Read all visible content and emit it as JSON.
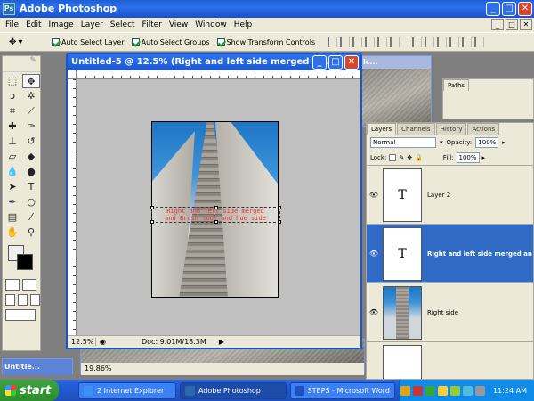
{
  "app": {
    "title": "Adobe Photoshop",
    "icon_letters": "Ps"
  },
  "window_controls": {
    "minimize": "_",
    "maximize": "□",
    "close": "✕"
  },
  "menu": [
    "File",
    "Edit",
    "Image",
    "Layer",
    "Select",
    "Filter",
    "View",
    "Window",
    "Help"
  ],
  "options_bar": {
    "auto_select_layer": "Auto Select Layer",
    "auto_select_groups": "Auto Select Groups",
    "show_transform_controls": "Show Transform Controls"
  },
  "document": {
    "title": "Untitled-5 @ 12.5% (Right and left side merged  an, ...",
    "overlay_line1": "Right and left side merged",
    "overlay_line2": "and Brush tool and hue side",
    "zoom": "12.5%",
    "doc_size": "Doc: 9.01M/18.3M"
  },
  "back_documents": {
    "minimized_title": "Untitle...",
    "behind_zoom": "19.86%",
    "partial_title": "lc..."
  },
  "paths_palette": {
    "tab": "Paths"
  },
  "layers_palette": {
    "tabs": [
      "Layers",
      "Channels",
      "History",
      "Actions"
    ],
    "blend_mode": "Normal",
    "opacity_label": "Opacity:",
    "opacity_value": "100%",
    "lock_label": "Lock:",
    "fill_label": "Fill:",
    "fill_value": "100%",
    "layers": [
      {
        "name": "Layer 2",
        "thumb": "T",
        "selected": false
      },
      {
        "name": "Right and left side merged  an",
        "thumb": "T",
        "selected": true
      },
      {
        "name": "Right side",
        "thumb": "",
        "selected": false
      },
      {
        "name": "",
        "thumb": "",
        "selected": false
      }
    ]
  },
  "taskbar": {
    "start": "start",
    "tasks": [
      {
        "label": "2 Internet Explorer",
        "active": false,
        "icon_color": "#3d8ff6"
      },
      {
        "label": "Adobe Photoshop",
        "active": true,
        "icon_color": "#2a6aa6"
      },
      {
        "label": "STEPS - Microsoft Word",
        "active": false,
        "icon_color": "#1e4fbb"
      }
    ],
    "time": "11:24 AM"
  },
  "colors": {
    "title_blue": "#2c6fea",
    "selection_blue": "#316ac5",
    "overlay_text": "#ee3333",
    "start_green": "#3fa13f"
  }
}
